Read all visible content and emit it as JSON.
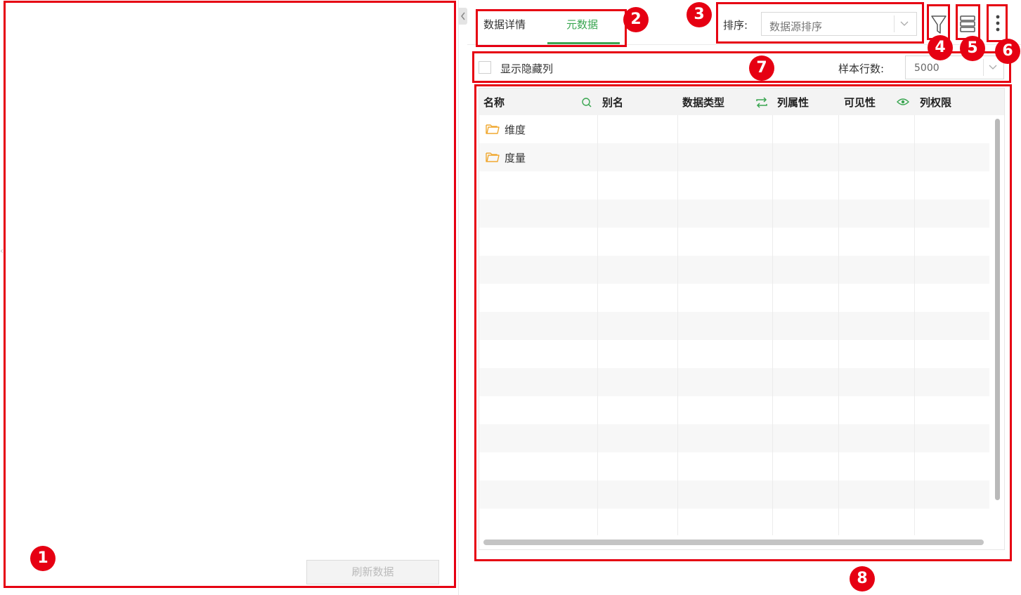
{
  "left_panel": {
    "refresh_button": "刷新数据"
  },
  "tabs": [
    {
      "label": "数据详情",
      "active": false
    },
    {
      "label": "元数据",
      "active": true
    }
  ],
  "sort": {
    "label": "排序:",
    "value": "数据源排序"
  },
  "toolbar": {
    "filter_icon": "filter-icon",
    "layout_icon": "list-layout-icon",
    "more_icon": "more-vertical-icon"
  },
  "options": {
    "show_hidden_columns_label": "显示隐藏列",
    "show_hidden_columns_checked": false,
    "sample_rows_label": "样本行数:",
    "sample_rows_value": "5000"
  },
  "table": {
    "columns": [
      {
        "label": "名称",
        "icon": "search-icon"
      },
      {
        "label": "别名",
        "icon": null
      },
      {
        "label": "数据类型",
        "icon": "swap-icon"
      },
      {
        "label": "列属性",
        "icon": null
      },
      {
        "label": "可见性",
        "icon": "eye-icon"
      },
      {
        "label": "列权限",
        "icon": null
      }
    ],
    "rows": [
      {
        "name": "维度",
        "type": "folder"
      },
      {
        "name": "度量",
        "type": "folder"
      }
    ]
  },
  "annotations": {
    "markers": [
      "1",
      "2",
      "3",
      "4",
      "5",
      "6",
      "7",
      "8"
    ]
  },
  "colors": {
    "accent_green": "#3aa651",
    "annotation_red": "#e60012",
    "folder_orange": "#f0a830"
  }
}
